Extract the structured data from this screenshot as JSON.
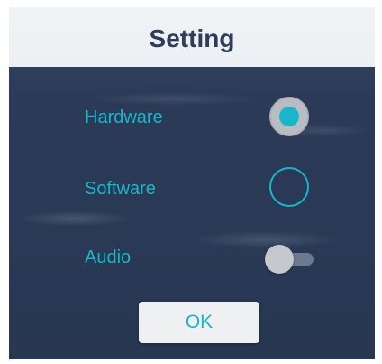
{
  "dialog": {
    "title": "Setting",
    "ok_label": "OK"
  },
  "options": {
    "hardware": {
      "label": "Hardware",
      "selected": true
    },
    "software": {
      "label": "Software",
      "selected": false
    },
    "audio": {
      "label": "Audio",
      "enabled": false
    }
  },
  "colors": {
    "accent": "#19b6c7",
    "title_text": "#2d3e59",
    "header_bg": "#eceff3",
    "panel_bg": "#2b3a55"
  }
}
